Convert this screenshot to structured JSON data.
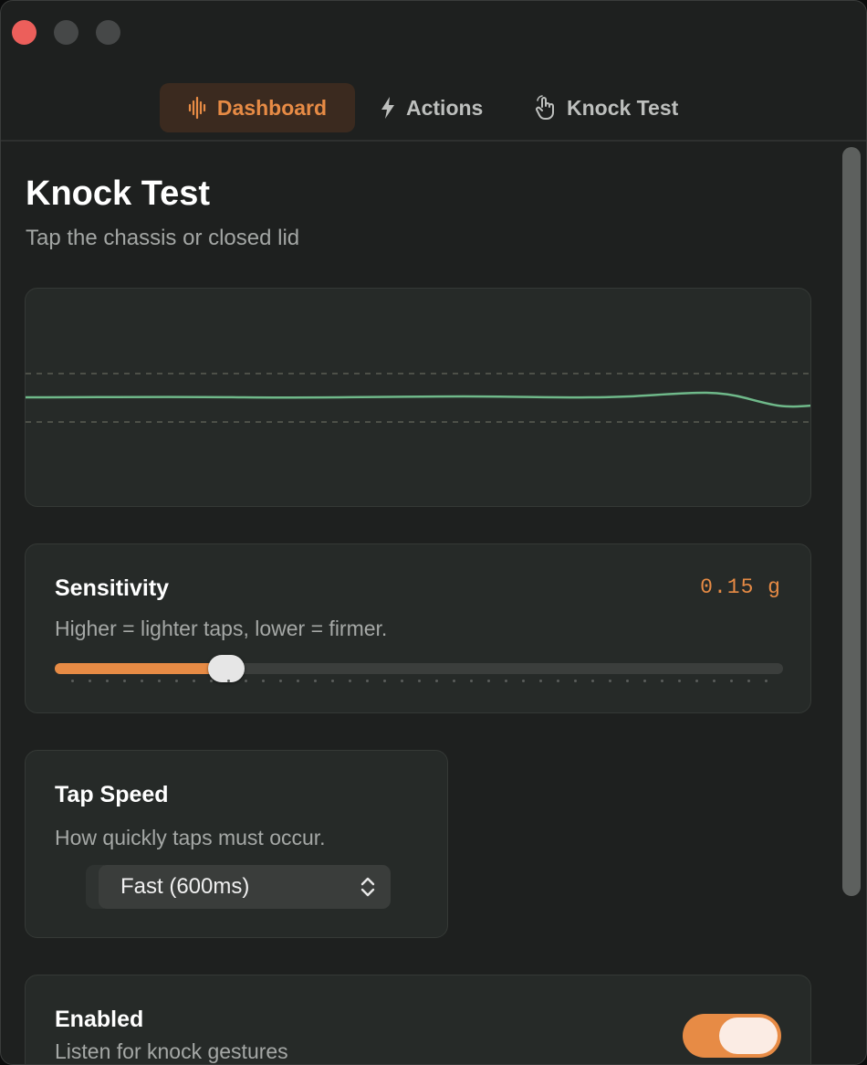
{
  "tabs": [
    {
      "label": "Dashboard",
      "icon": "waveform-icon",
      "active": true
    },
    {
      "label": "Actions",
      "icon": "bolt-icon",
      "active": false
    },
    {
      "label": "Knock Test",
      "icon": "hand-tap-icon",
      "active": false
    }
  ],
  "page": {
    "title": "Knock Test",
    "subtitle": "Tap the chassis or closed lid"
  },
  "sensitivity": {
    "title": "Sensitivity",
    "value": "0.15 g",
    "description": "Higher = lighter taps, lower = firmer.",
    "slider_fraction": 0.235
  },
  "tap_speed": {
    "title": "Tap Speed",
    "description": "How quickly taps must occur.",
    "selected": "Fast (600ms)"
  },
  "enabled": {
    "title": "Enabled",
    "description": "Listen for knock gestures",
    "on": true
  },
  "colors": {
    "accent": "#e78b45",
    "signal": "#6fb98a",
    "threshold": "#5a5d52"
  }
}
